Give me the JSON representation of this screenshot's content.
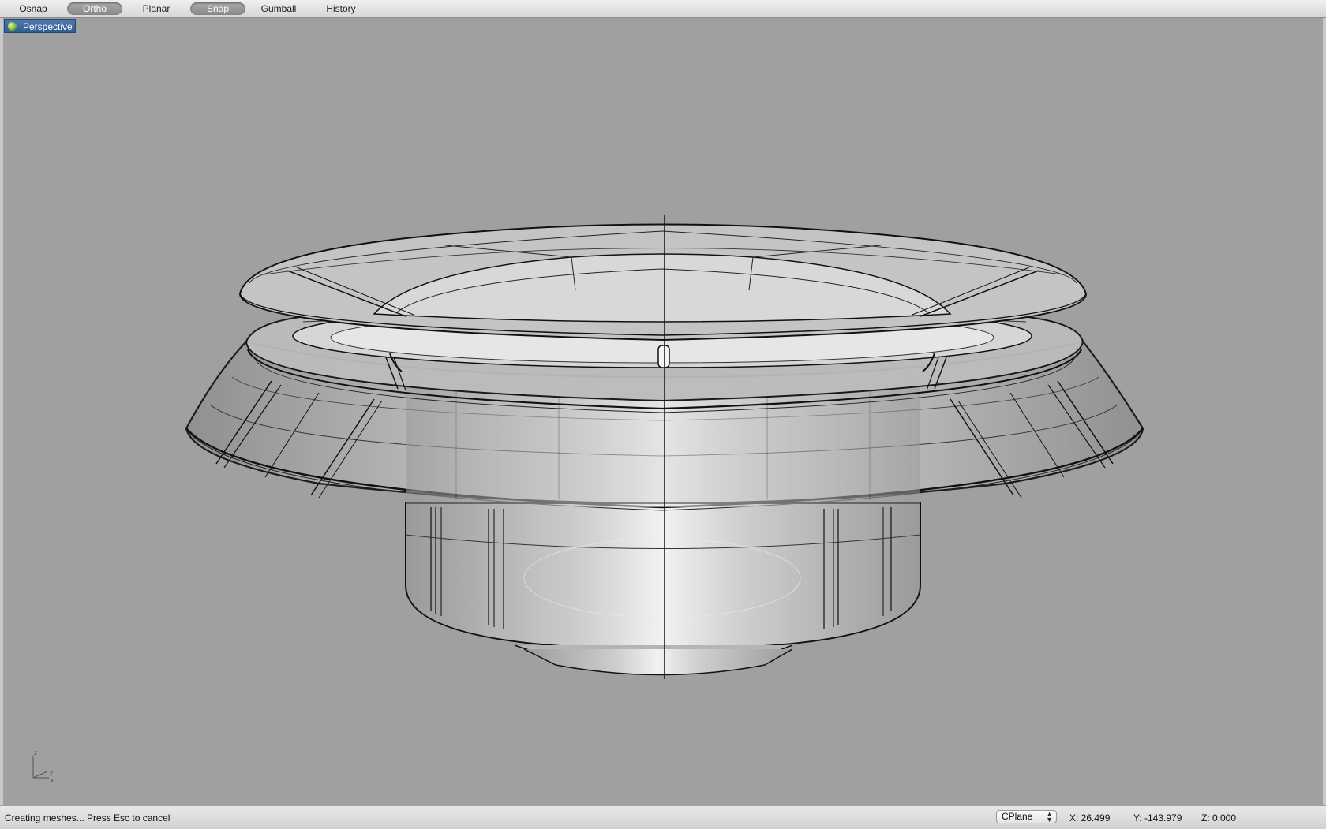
{
  "toolbar": {
    "buttons": [
      {
        "label": "Osnap",
        "active": false
      },
      {
        "label": "Ortho",
        "active": true
      },
      {
        "label": "Planar",
        "active": false
      },
      {
        "label": "Snap",
        "active": true
      },
      {
        "label": "Gumball",
        "active": false
      },
      {
        "label": "History",
        "active": false
      }
    ]
  },
  "viewport": {
    "label": "Perspective",
    "axis_z": "z",
    "axis_x": "x",
    "axis_y": "y"
  },
  "status": {
    "message": "Creating meshes... Press Esc to cancel",
    "cplane": "CPlane",
    "x": "X: 26.499",
    "y": "Y: -143.979",
    "z": "Z: 0.000"
  },
  "colors": {
    "viewport_bg": "#a0a0a0",
    "label_bg": "#3b6698"
  }
}
